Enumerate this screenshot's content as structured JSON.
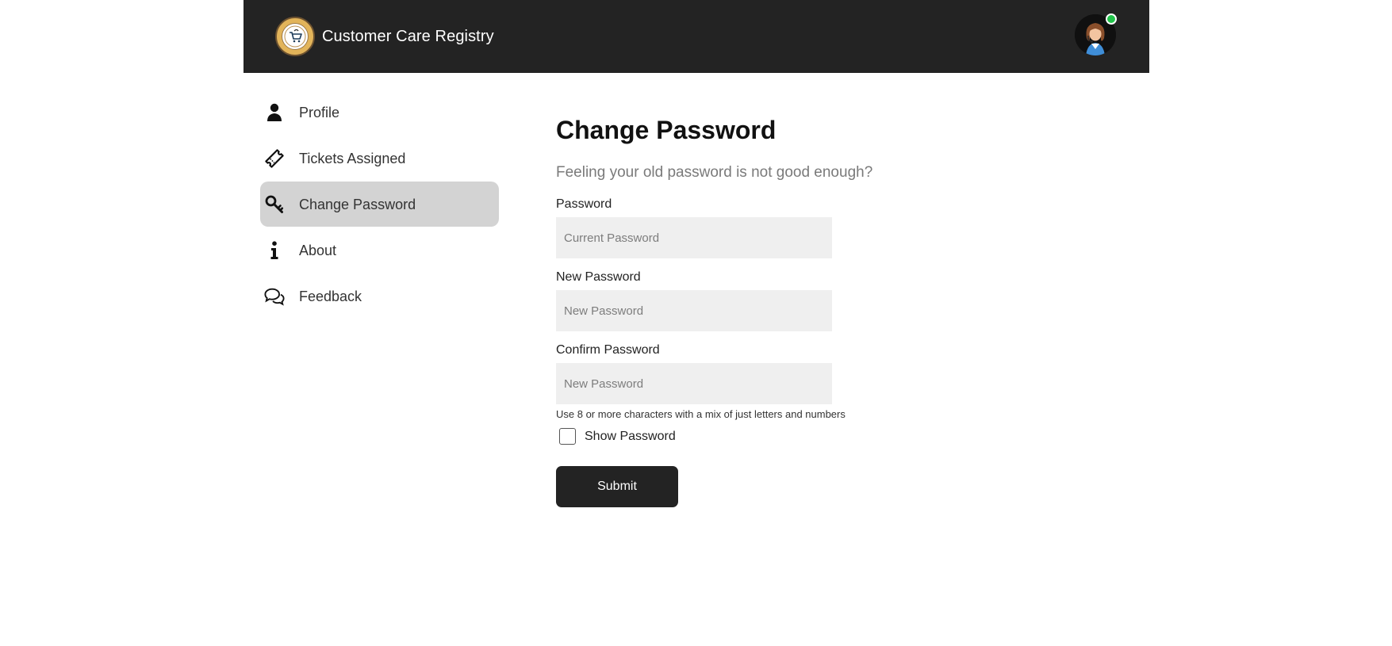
{
  "header": {
    "title": "Customer Care Registry",
    "logo_icon": "customer-care-logo",
    "logo_text_top": "CUSTOMER",
    "logo_text_mid": "CARE",
    "logo_text_bottom": "REGISTRY",
    "avatar_icon": "support-agent-avatar",
    "status_color": "#21c34a"
  },
  "sidebar": {
    "items": [
      {
        "label": "Profile",
        "icon": "person-icon",
        "active": false
      },
      {
        "label": "Tickets Assigned",
        "icon": "ticket-icon",
        "active": false
      },
      {
        "label": "Change Password",
        "icon": "key-icon",
        "active": true
      },
      {
        "label": "About",
        "icon": "info-icon",
        "active": false
      },
      {
        "label": "Feedback",
        "icon": "chat-bubbles-icon",
        "active": false
      }
    ]
  },
  "form": {
    "title": "Change Password",
    "subtitle": "Feeling your old password is not good enough?",
    "password_label": "Password",
    "password_placeholder": "Current Password",
    "new_password_label": "New Password",
    "new_password_placeholder": "New Password",
    "confirm_password_label": "Confirm Password",
    "confirm_password_placeholder": "New Password",
    "hint": "Use 8 or more characters with a mix of just letters and numbers",
    "show_password_label": "Show Password",
    "show_password_checked": false,
    "submit_label": "Submit"
  },
  "colors": {
    "header_bg": "#232323",
    "active_item_bg": "#d3d3d3",
    "field_bg": "#efefef",
    "button_bg": "#232323"
  }
}
